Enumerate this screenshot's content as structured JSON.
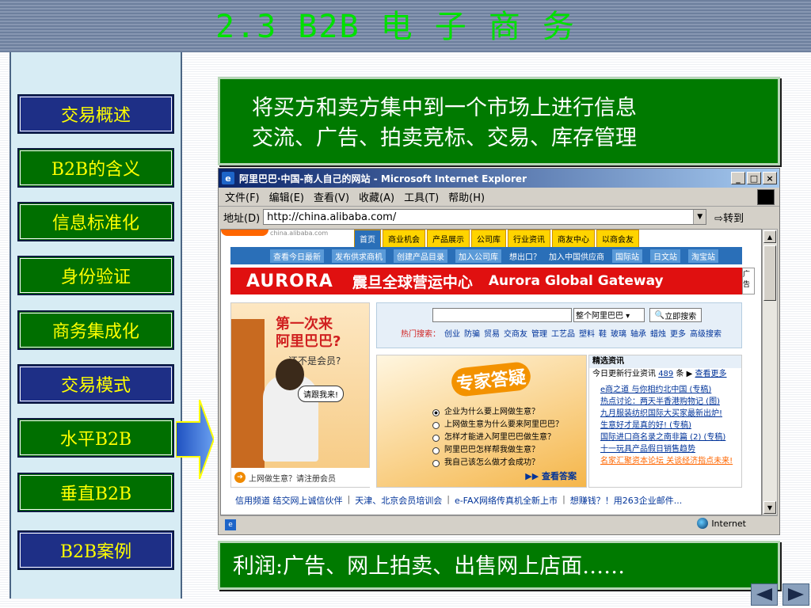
{
  "slide": {
    "title": "2.3  B2B 电 子 商 务"
  },
  "nav": {
    "items": [
      {
        "label": "交易概述",
        "style": "blue"
      },
      {
        "label": "B2B的含义",
        "style": "green"
      },
      {
        "label": "信息标准化",
        "style": "green"
      },
      {
        "label": "身份验证",
        "style": "green"
      },
      {
        "label": "商务集成化",
        "style": "green"
      },
      {
        "label": "交易模式",
        "style": "blue"
      },
      {
        "label": "水平B2B",
        "style": "green"
      },
      {
        "label": "垂直B2B",
        "style": "green"
      },
      {
        "label": "B2B案例",
        "style": "blue"
      }
    ]
  },
  "top_box": {
    "line1": "将买方和卖方集中到一个市场上进行信息",
    "line2": "交流、广告、拍卖竞标、交易、库存管理"
  },
  "bottom_box": {
    "text": "利润:广告、网上拍卖、出售网上店面……"
  },
  "browser": {
    "window_title": "阿里巴巴·中国-商人自己的网站 - Microsoft Internet Explorer",
    "menu": [
      "文件(F)",
      "编辑(E)",
      "查看(V)",
      "收藏(A)",
      "工具(T)",
      "帮助(H)"
    ],
    "address_label": "地址(D)",
    "address_value": "http://china.alibaba.com/",
    "go_label": "转到",
    "status_zone": "Internet",
    "page": {
      "logo_text": "china.alibaba.com",
      "tabs": [
        "首页",
        "商业机会",
        "产品展示",
        "公司库",
        "行业资讯",
        "商友中心",
        "以商会友"
      ],
      "subnav": [
        "查看今日最新",
        "发布供求商机",
        "创建产品目录",
        "加入公司库",
        "想出口？",
        "加入中国供应商",
        "国际站",
        "日文站",
        "淘宝站"
      ],
      "banner": {
        "brand": "AURORA",
        "cn": "震旦全球营运中心",
        "en": "Aurora Global Gateway",
        "side": "广告"
      },
      "promo": {
        "headline1": "第一次来",
        "headline2": "阿里巴巴?",
        "sub": "还不是会员?",
        "bubble": "请跟我来!",
        "footer": "上网做生意？请注册会员"
      },
      "search": {
        "select": "整个阿里巴巴",
        "button": "立即搜索",
        "hot_label": "热门搜索：",
        "hot_terms": [
          "创业",
          "防骗",
          "贸易",
          "交商友",
          "管理",
          "工艺品",
          "塑料",
          "鞋",
          "玻璃",
          "轴承",
          "蜡烛"
        ],
        "more": "更多",
        "advanced": "高级搜索"
      },
      "expert": {
        "title": "专家答疑",
        "questions": [
          "企业为什么要上网做生意？",
          "上网做生意为什么要来阿里巴巴？",
          "怎样才能进入阿里巴巴做生意？",
          "阿里巴巴怎样帮我做生意？",
          "我自己该怎么做才会成功？"
        ],
        "selected_index": 0,
        "button": "查看答案"
      },
      "picks": {
        "title": "精选资讯",
        "sub_prefix": "今日更新行业资讯",
        "count": "489",
        "sub_unit": "条",
        "more": "查看更多",
        "items": [
          "e商之道  与你相约北中国 (专稿)",
          "热点讨论：两天半香港购物记 (图)",
          "九月服装纺织国际大买家最新出炉!",
          "生意好才是真的好! (专稿)",
          "国际进口商名录之南非篇 (2) (专稿)",
          "十一玩具产品假日销售趋势",
          "名家汇聚资本论坛 关谈经济指点未来!"
        ]
      },
      "bottom_links": [
        "信用频道 结交网上诚信伙伴",
        "天津、北京会员培训会",
        "e-FAX网络传真机全新上市",
        "想赚钱？！用263企业邮件..."
      ]
    }
  },
  "colors": {
    "title_green": "#00e000",
    "box_green": "#007a00",
    "nav_blue": "#1e2f86",
    "nav_text": "#ffff00"
  }
}
